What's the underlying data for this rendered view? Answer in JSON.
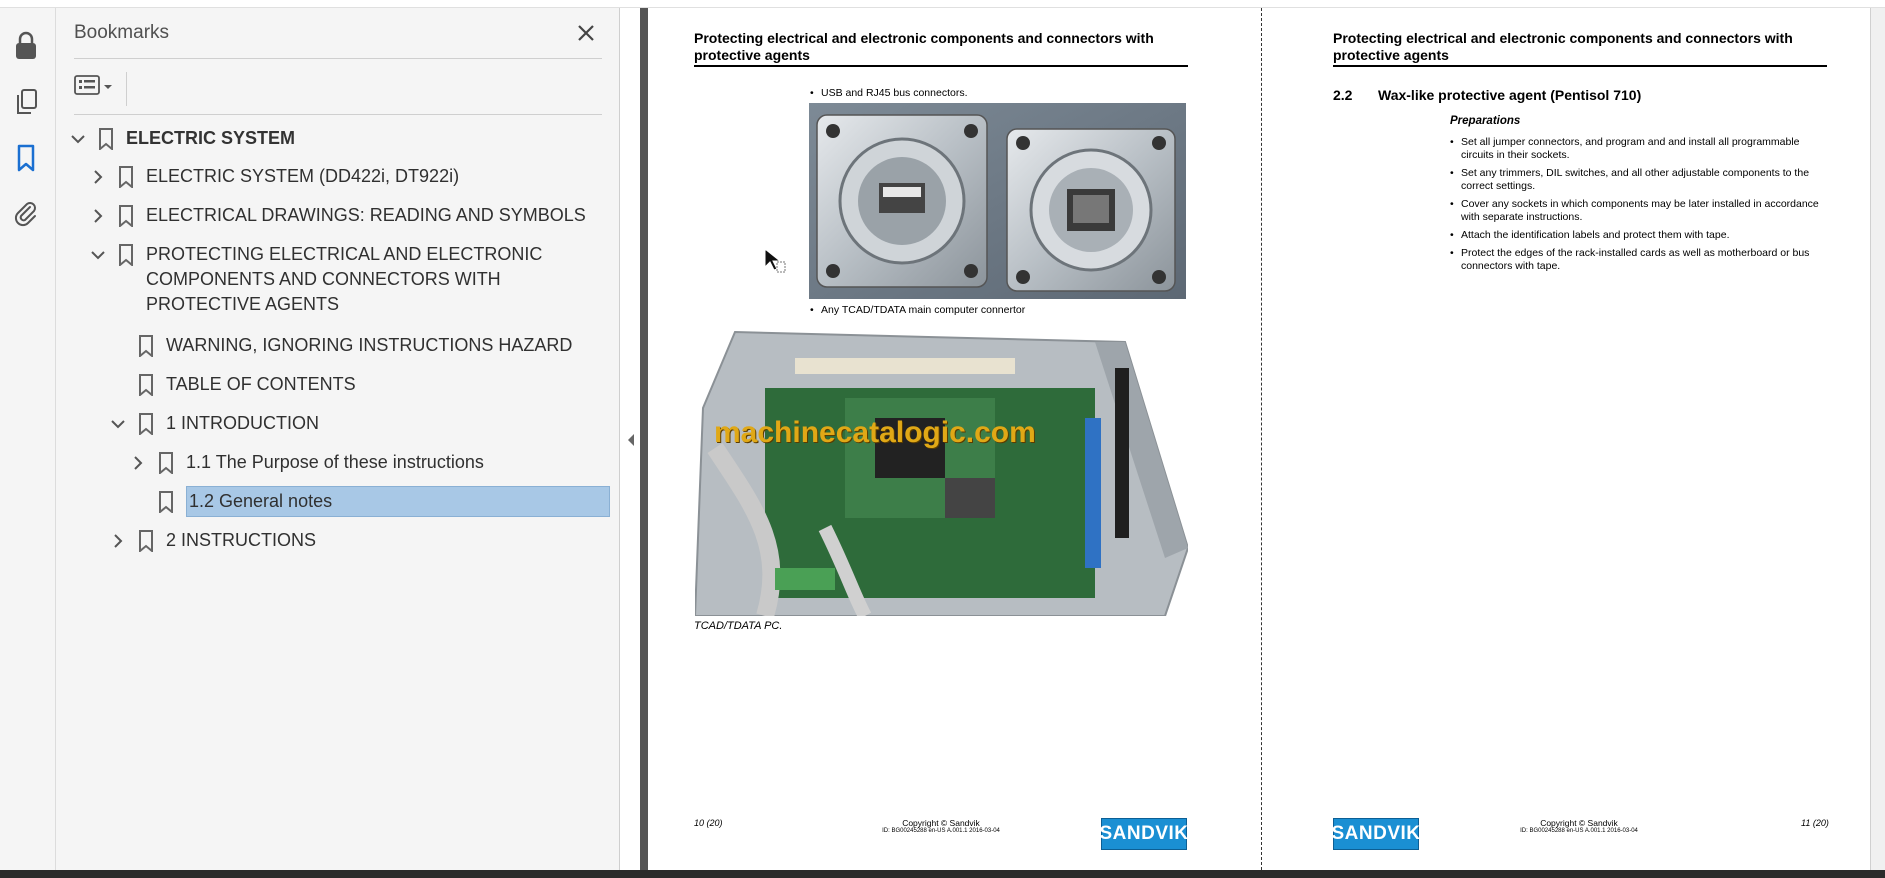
{
  "sidebar": {
    "title": "Bookmarks",
    "bookmarks": [
      {
        "label": "ELECTRIC SYSTEM"
      },
      {
        "label": "ELECTRIC SYSTEM (DD422i, DT922i)"
      },
      {
        "label": "ELECTRICAL DRAWINGS: READING AND SYMBOLS"
      },
      {
        "label": "PROTECTING ELECTRICAL AND ELECTRONIC COMPONENTS AND CONNECTORS WITH PROTECTIVE AGENTS"
      },
      {
        "label": "WARNING, IGNORING INSTRUCTIONS HAZARD"
      },
      {
        "label": "TABLE OF CONTENTS"
      },
      {
        "label": "1 INTRODUCTION"
      },
      {
        "label": "1.1 The Purpose of these instructions"
      },
      {
        "label": "1.2 General notes"
      },
      {
        "label": "2 INSTRUCTIONS"
      }
    ]
  },
  "page_left": {
    "header": "Protecting electrical and electronic components and connectors with protective agents",
    "bullet1": "USB and RJ45 bus connectors.",
    "bullet2": "Any TCAD/TDATA main computer connertor",
    "caption": "TCAD/TDATA PC.",
    "watermark": "machinecatalogic.com",
    "page_num": "10 (20)",
    "copyright": "Copyright © Sandvik",
    "doc_id": "ID: BG00245288 en-US A.001.1 2016-03-04",
    "logo": "SANDVIK"
  },
  "page_right": {
    "header": "Protecting electrical and electronic components and connectors with protective agents",
    "section_num": "2.2",
    "section_title": "Wax-like protective agent (Pentisol 710)",
    "prep_title": "Preparations",
    "items": [
      "Set all jumper connectors, and program and and install all programmable circuits in their sockets.",
      "Set any trimmers, DIL switches, and all other adjustable components to the correct settings.",
      "Cover any sockets in which components may be later installed in accordance with separate instructions.",
      "Attach the identification labels and protect them with tape.",
      "Protect the edges of the rack-installed cards as well as motherboard or bus connectors with tape."
    ],
    "page_num": "11 (20)",
    "copyright": "Copyright © Sandvik",
    "doc_id": "ID: BG00245288 en-US A.001.1 2016-03-04",
    "logo": "SANDVIK"
  },
  "colors": {
    "selection": "#a8c8e6",
    "accent_icon": "#1a6fd1",
    "logo_blue": "#1a8fd3"
  },
  "icons": [
    "lock-icon",
    "pages-icon",
    "bookmark-icon",
    "attachment-icon",
    "close-icon",
    "options-icon"
  ]
}
